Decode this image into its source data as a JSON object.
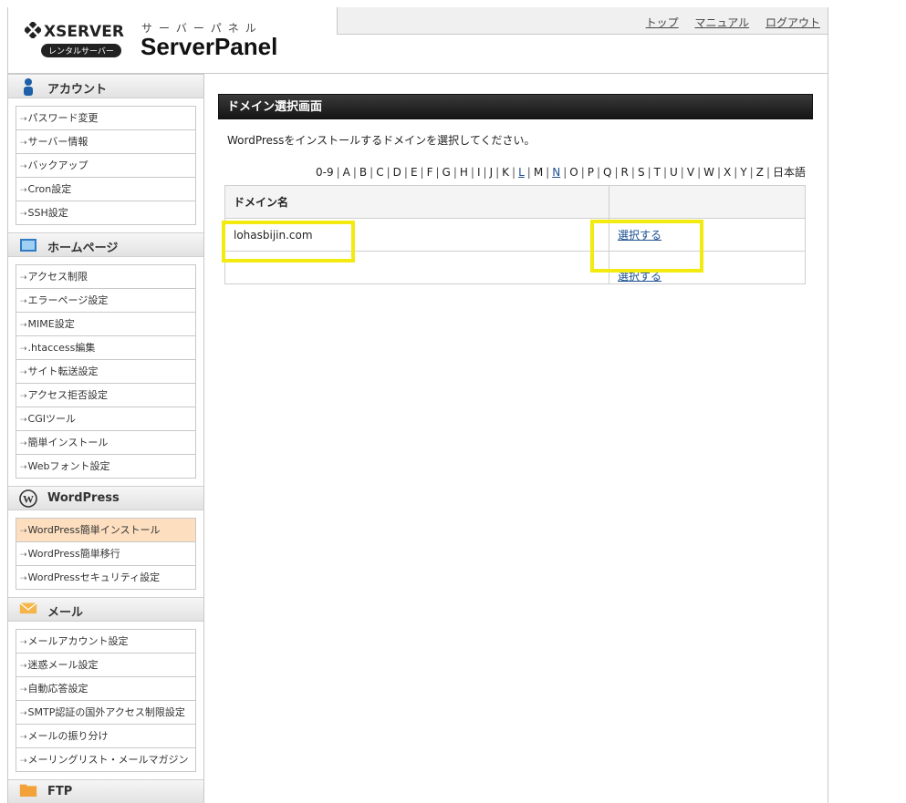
{
  "brand": {
    "logo_text": "XSERVER",
    "logo_sub": "レンタルサーバー",
    "panel_kana": "サーバーパネル",
    "panel_title": "ServerPanel"
  },
  "header_links": [
    "トップ",
    "マニュアル",
    "ログアウト"
  ],
  "sidebar": [
    {
      "title": "アカウント",
      "icon": "person-icon",
      "items": [
        "パスワード変更",
        "サーバー情報",
        "バックアップ",
        "Cron設定",
        "SSH設定"
      ]
    },
    {
      "title": "ホームページ",
      "icon": "monitor-icon",
      "items": [
        "アクセス制限",
        "エラーページ設定",
        "MIME設定",
        ".htaccess編集",
        "サイト転送設定",
        "アクセス拒否設定",
        "CGIツール",
        "簡単インストール",
        "Webフォント設定"
      ]
    },
    {
      "title": "WordPress",
      "icon": "wordpress-icon",
      "items": [
        "WordPress簡単インストール",
        "WordPress簡単移行",
        "WordPressセキュリティ設定"
      ],
      "active_index": 0
    },
    {
      "title": "メール",
      "icon": "envelope-icon",
      "items": [
        "メールアカウント設定",
        "迷惑メール設定",
        "自動応答設定",
        "SMTP認証の国外アクセス制限設定",
        "メールの振り分け",
        "メーリングリスト・メールマガジン"
      ]
    },
    {
      "title": "FTP",
      "icon": "folder-icon",
      "items": []
    }
  ],
  "content": {
    "heading": "ドメイン選択画面",
    "instruction": "WordPressをインストールするドメインを選択してください。",
    "alpha_index": [
      "0-9",
      "A",
      "B",
      "C",
      "D",
      "E",
      "F",
      "G",
      "H",
      "I",
      "J",
      "K",
      "L",
      "M",
      "N",
      "O",
      "P",
      "Q",
      "R",
      "S",
      "T",
      "U",
      "V",
      "W",
      "X",
      "Y",
      "Z",
      "日本語"
    ],
    "alpha_linked": [
      "L",
      "N"
    ],
    "table": {
      "headers": [
        "ドメイン名",
        ""
      ],
      "rows": [
        {
          "domain": "lohasbijin.com",
          "action": "選択する"
        }
      ],
      "ghost_action": "選択する"
    }
  },
  "colors": {
    "highlight": "#f3ea10",
    "active_item": "#fddfc0",
    "link": "#1a4f8f"
  }
}
